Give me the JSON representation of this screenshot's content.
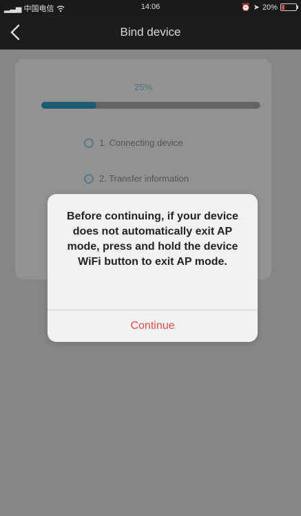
{
  "status_bar": {
    "carrier": "中国电信",
    "time": "14:06",
    "battery_text": "20%",
    "battery_level": 0.2,
    "wifi_icon": "wifi-icon",
    "battery_icon": "battery-icon"
  },
  "nav": {
    "title": "Bind device",
    "back_icon": "chevron-left-icon"
  },
  "progress": {
    "text": "25%",
    "value": 0.25,
    "fill_color": "#1f5f7a"
  },
  "steps": [
    {
      "label": "1. Connecting device"
    },
    {
      "label": "2. Transfer information"
    }
  ],
  "dialog": {
    "message": "Before continuing, if your device does not automatically exit AP mode, press and hold the device WiFi button to exit AP mode.",
    "button_label": "Continue",
    "button_color": "#e24a4a"
  }
}
